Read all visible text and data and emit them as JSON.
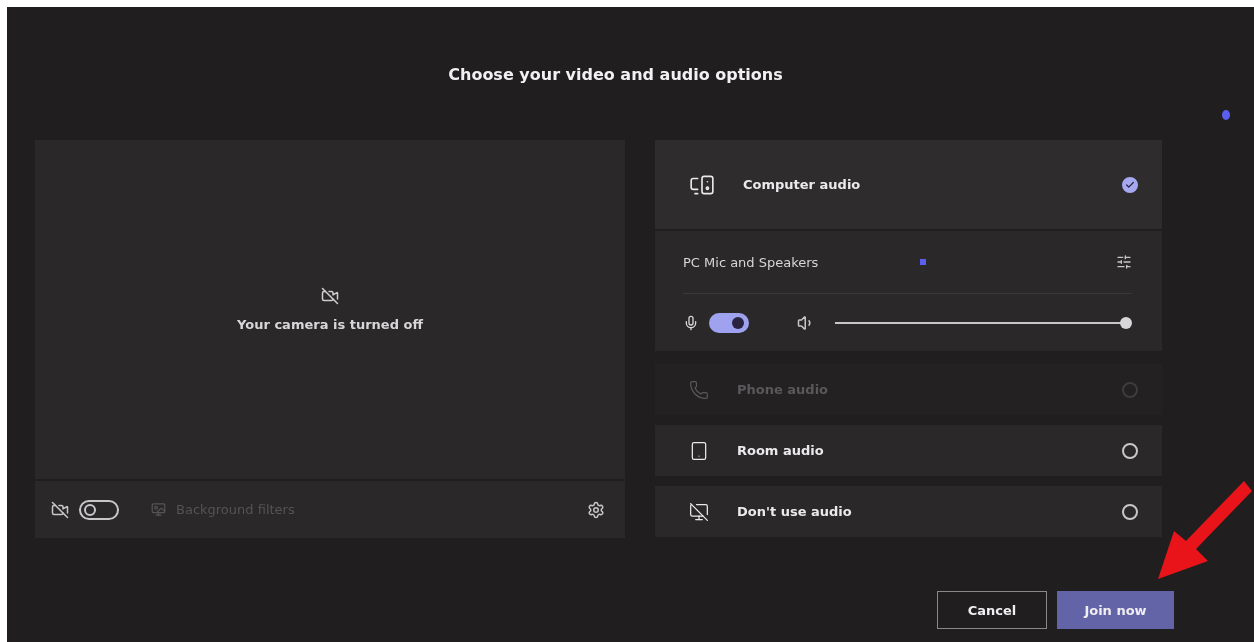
{
  "title": "Choose your video and audio options",
  "camera": {
    "message": "Your camera is turned off",
    "on": false
  },
  "background_filters": {
    "label": "Background filters",
    "disabled": true
  },
  "audio_options": [
    {
      "kind": "computer",
      "label": "Computer audio",
      "selected": true,
      "disabled": false
    },
    {
      "kind": "phone",
      "label": "Phone audio",
      "selected": false,
      "disabled": true
    },
    {
      "kind": "room",
      "label": "Room audio",
      "selected": false,
      "disabled": false
    },
    {
      "kind": "none",
      "label": "Don't use audio",
      "selected": false,
      "disabled": false
    }
  ],
  "device": {
    "name": "PC Mic and Speakers",
    "mic_on": true,
    "speaker": {
      "level": 0.98
    }
  },
  "buttons": {
    "cancel": "Cancel",
    "join": "Join now"
  }
}
